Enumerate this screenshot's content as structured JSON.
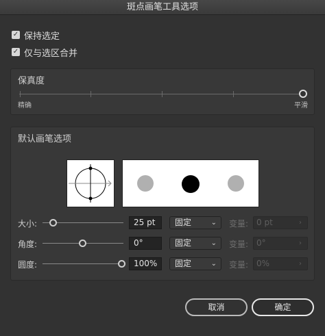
{
  "window": {
    "title": "斑点画笔工具选项"
  },
  "options": {
    "keep_selected": {
      "label": "保持选定",
      "checked": true
    },
    "merge_only_selection": {
      "label": "仅与选区合并",
      "checked": true
    }
  },
  "fidelity": {
    "title": "保真度",
    "left_label": "精确",
    "right_label": "平滑",
    "value_fraction": 1.0
  },
  "brush": {
    "title": "默认画笔选项",
    "size": {
      "label": "大小:",
      "value": "25 pt",
      "mode": "固定",
      "variation_label": "变量:",
      "variation": "0 pt",
      "slider_fraction": 0.05
    },
    "angle": {
      "label": "角度:",
      "value": "0°",
      "mode": "固定",
      "variation_label": "变量:",
      "variation": "0°",
      "slider_fraction": 0.5
    },
    "roundness": {
      "label": "圆度:",
      "value": "100%",
      "mode": "固定",
      "variation_label": "变量:",
      "variation": "0%",
      "slider_fraction": 1.0
    }
  },
  "buttons": {
    "cancel": "取消",
    "ok": "确定"
  },
  "colors": {
    "background": "#323232",
    "dot_gray": "#b0b0b0",
    "dot_black": "#000000"
  }
}
